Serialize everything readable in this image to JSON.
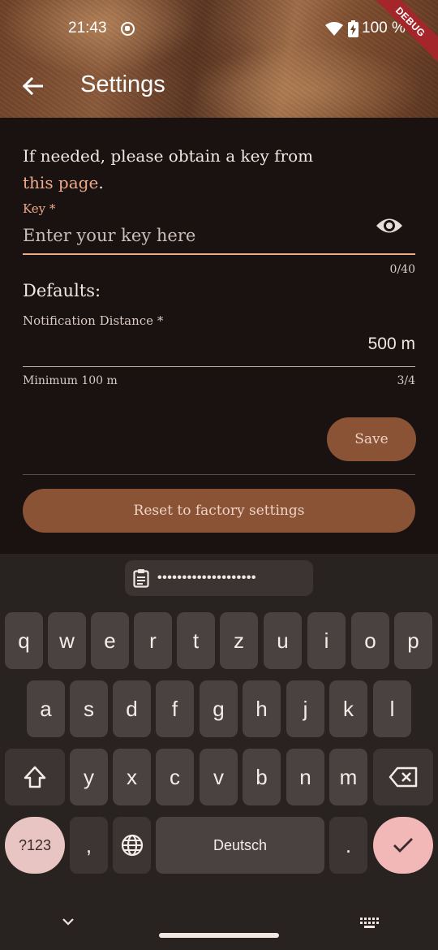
{
  "status_bar": {
    "time": "21:43",
    "battery": "100 %",
    "debug_label": "DEBUG"
  },
  "app_bar": {
    "title": "Settings",
    "back_icon": "arrow-left-icon"
  },
  "intro": {
    "text": "If needed, please obtain a key from",
    "link_text": "this page",
    "suffix": "."
  },
  "key_field": {
    "label": "Key *",
    "placeholder": "Enter your key here",
    "value": "",
    "counter": "0/40",
    "visibility_icon": "eye-icon"
  },
  "defaults": {
    "heading": "Defaults:",
    "notification_distance": {
      "label": "Notification Distance *",
      "value": "500 m",
      "helper": "Minimum 100 m",
      "counter": "3/4"
    }
  },
  "buttons": {
    "save": "Save",
    "reset": "Reset to factory settings"
  },
  "keyboard": {
    "clipboard_text": "••••••••••••••••••••",
    "row1": [
      "q",
      "w",
      "e",
      "r",
      "t",
      "z",
      "u",
      "i",
      "o",
      "p"
    ],
    "row2": [
      "a",
      "s",
      "d",
      "f",
      "g",
      "h",
      "j",
      "k",
      "l"
    ],
    "row3": [
      "y",
      "x",
      "c",
      "v",
      "b",
      "n",
      "m"
    ],
    "num_key": "?123",
    "comma_key": ",",
    "space_label": "Deutsch",
    "period_key": ".",
    "colors": {
      "accent": "#8b5335",
      "key_bg": "#4a4240",
      "done_key": "#f1b8b7"
    }
  }
}
